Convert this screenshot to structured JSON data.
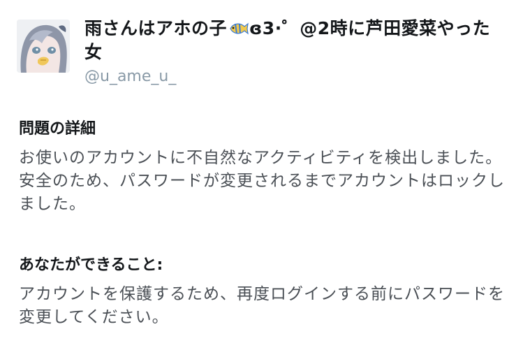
{
  "profile": {
    "display_name_part1": "雨さんはアホの子",
    "display_name_part2": "ɞ3·゜@2時に芦田愛菜やった女",
    "handle": "@u_ame_u_",
    "emoji_icon": "tropical-fish-icon"
  },
  "details": {
    "title": "問題の詳細",
    "body": "お使いのアカウントに不自然なアクティビティを検出しました。安全のため、パスワードが変更されるまでアカウントはロックしました。"
  },
  "actions": {
    "title": "あなたができること:",
    "body": "アカウントを保護するため、再度ログインする前にパスワードを変更してください。"
  }
}
